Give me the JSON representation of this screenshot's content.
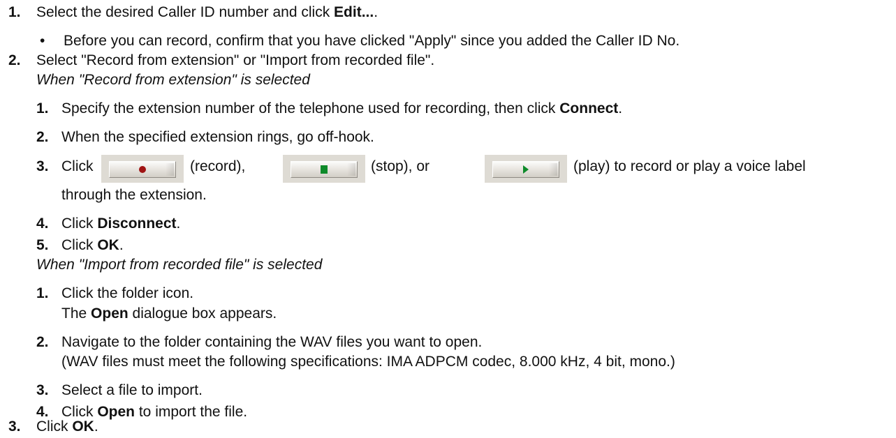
{
  "step1": {
    "num": "1.",
    "pre": "Select the desired Caller ID number and click ",
    "bold": "Edit...",
    "post": ".",
    "bullet": "Before you can record, confirm that you have clicked \"Apply\" since you added the Caller ID No."
  },
  "step2": {
    "num": "2.",
    "text": "Select \"Record from extension\" or \"Import from recorded file\".",
    "record_heading": "When \"Record from extension\" is selected",
    "record_steps": [
      {
        "num": "1.",
        "pre": "Specify the extension number of the telephone used for recording, then click ",
        "bold": "Connect",
        "post": "."
      },
      {
        "num": "2.",
        "text": "When the specified extension rings, go off-hook."
      },
      {
        "num": "3.",
        "click": "Click",
        "record": "(record),",
        "stop": "(stop), or",
        "play": "(play) to record or play a voice label",
        "cont": "through the extension."
      },
      {
        "num": "4.",
        "pre": "Click ",
        "bold": "Disconnect",
        "post": "."
      },
      {
        "num": "5.",
        "pre": "Click ",
        "bold": "OK",
        "post": "."
      }
    ],
    "import_heading": "When \"Import from recorded file\" is selected",
    "import_steps": [
      {
        "num": "1.",
        "text": "Click the folder icon.",
        "pre2": "The ",
        "bold2": "Open",
        "post2": " dialogue box appears."
      },
      {
        "num": "2.",
        "text": "Navigate to the folder containing the WAV files you want to open.",
        "text2": "(WAV files must meet the following specifications: IMA ADPCM codec, 8.000 kHz, 4 bit, mono.)"
      },
      {
        "num": "3.",
        "text": "Select a file to import."
      },
      {
        "num": "4.",
        "pre": "Click ",
        "bold": "Open",
        "post": " to import the file."
      }
    ]
  },
  "step3": {
    "num": "3.",
    "pre": "Click ",
    "bold": "OK",
    "post": "."
  },
  "colors": {
    "record_glyph": "#a01414",
    "stop_glyph": "#0e8a2a",
    "play_glyph": "#0e8a2a",
    "button_bg": "#dedbd4"
  },
  "icons": {
    "record": "record-icon",
    "stop": "stop-icon",
    "play": "play-icon"
  }
}
